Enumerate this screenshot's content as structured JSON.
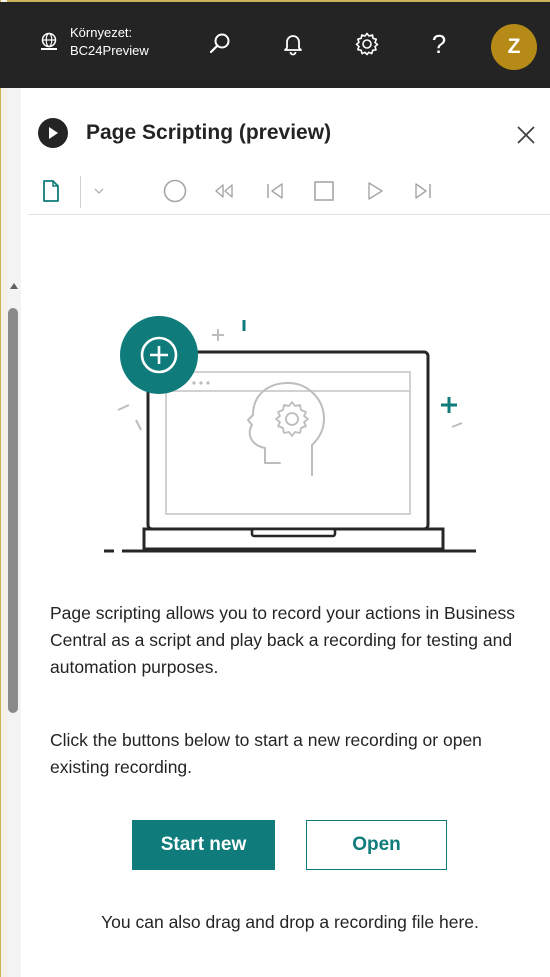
{
  "topbar": {
    "env_label": "Környezet:",
    "env_name": "BC24Preview",
    "search_icon": "search-icon",
    "bell_icon": "bell-icon",
    "settings_icon": "gear-icon",
    "help_label": "?",
    "avatar_initial": "Z",
    "avatar_color": "#b58a16"
  },
  "panel": {
    "title": "Page Scripting (preview)",
    "toolbar": [
      "new-file-icon",
      "chevron-down-icon",
      "record-icon",
      "rewind-icon",
      "skip-back-icon",
      "stop-icon",
      "play-icon",
      "skip-forward-icon"
    ]
  },
  "content": {
    "description": "Page scripting allows you to record your actions in Business Central as a script and play back a recording for testing and automation purposes.",
    "instruction": "Click the buttons below to start a new recording or open existing recording.",
    "start_new_label": "Start new",
    "open_label": "Open",
    "drop_hint": "You can also drag and drop a recording file here.",
    "accent_color": "#0f7c7b"
  }
}
